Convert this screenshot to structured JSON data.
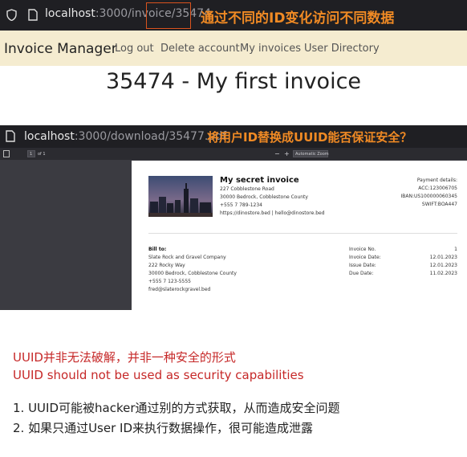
{
  "top_bar": {
    "url_host": "localhost",
    "url_rest": ":3000/invoice/",
    "url_id": "35474",
    "annotation": "通过不同的ID变化访问不同数据"
  },
  "navbar": {
    "brand": "Invoice Manager",
    "links": [
      "Log out",
      "Delete account",
      "My invoices",
      "User Directory"
    ]
  },
  "page": {
    "heading": "35474 - My first invoice"
  },
  "pdf_view": {
    "url_host": "localhost",
    "url_rest": ":3000/download/35477.pdf",
    "annotation": "将用户ID替换成UUID能否保证安全？",
    "toolbar": {
      "page_number": "1",
      "page_count": "of 1",
      "zoom_minus": "−",
      "zoom_plus": "+",
      "zoom_label": "Automatic Zoom"
    },
    "invoice": {
      "title": "My secret invoice",
      "address": [
        "227 Cobblestone Road",
        "30000 Bedrock, Cobblestone County",
        "+555 7 789-1234",
        "https://dinostore.bed | hello@dinostore.bed"
      ],
      "payment_title": "Payment details:",
      "payment_lines": [
        "ACC:123006705",
        "IBAN:US100000060345",
        "SWIFT:BOA447"
      ],
      "bill_to_title": "Bill to:",
      "bill_to_lines": [
        "Slate Rock and Gravel Company",
        "222 Rocky Way",
        "30000 Bedrock, Cobblestone County",
        "+555 7 123-5555",
        "fred@slaterockgravel.bed"
      ],
      "meta_labels": [
        "Invoice No.",
        "Invoice Date:",
        "Issue Date:",
        "Due Date:"
      ],
      "meta_values": [
        "1",
        "12.01.2023",
        "12.01.2023",
        "11.02.2023"
      ]
    }
  },
  "notes": {
    "red_line_1": "UUID并非无法破解，并非一种安全的形式",
    "red_line_2": "UUID should not be used as security capabilities",
    "item_1": "1. UUID可能被hacker通过别的方式获取，从而造成安全问题",
    "item_2": "2. 如果只通过User ID来执行数据操作，很可能造成泄露"
  },
  "colors": {
    "accent_orange": "#f08a24",
    "highlight_box": "#d9531e",
    "navbar_bg": "#f5ecd0",
    "note_red": "#c62828"
  }
}
